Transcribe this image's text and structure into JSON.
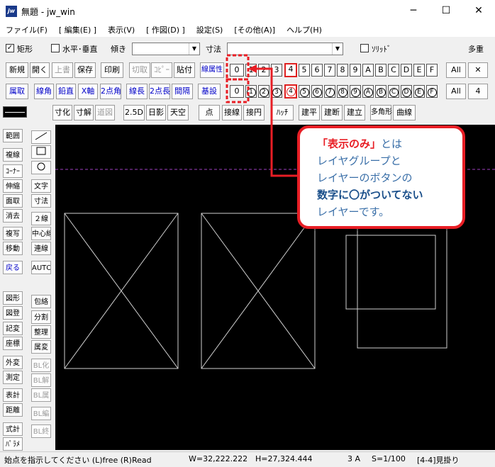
{
  "window": {
    "title": "無題 - jw_win",
    "logo": "jw",
    "minimize": "─",
    "maximize": "☐",
    "close": "✕"
  },
  "menu": [
    "ファイル(F)",
    "[ 編集(E) ]",
    "表示(V)",
    "[ 作図(D) ]",
    "設定(S)",
    "[その他(A)]",
    "ヘルプ(H)"
  ],
  "options": {
    "rect_label": "矩形",
    "rect_checked": "✓",
    "hv_label": "水平･垂直",
    "slope_label": "傾き",
    "dim_label": "寸法",
    "solid_label": "ｿﾘｯﾄﾞ",
    "multi_label": "多重"
  },
  "toolbar1": [
    "新規",
    "開く",
    "上書",
    "保存",
    "印刷",
    "切取",
    "ｺﾋﾟｰ",
    "貼付",
    "線属性"
  ],
  "toolbar2": [
    "属取",
    "線角",
    "鉛直",
    "X軸",
    "2点角",
    "線長",
    "2点長",
    "間隔",
    "基設"
  ],
  "toolbar3": [
    "寸化",
    "寸解",
    "道図",
    "2.5D",
    "日影",
    "天空",
    "点",
    "接線",
    "接円",
    "ﾊｯﾁ",
    "建平",
    "建断",
    "建立",
    "多角形",
    "曲線"
  ],
  "group_buttons": [
    "0",
    "1",
    "2",
    "3",
    "4",
    "5",
    "6",
    "7",
    "8",
    "9",
    "A",
    "B",
    "C",
    "D",
    "E",
    "F"
  ],
  "layer_buttons": [
    "0",
    "1",
    "2",
    "3",
    "4",
    "5",
    "6",
    "7",
    "8",
    "9",
    "A",
    "B",
    "C",
    "D",
    "E",
    "F"
  ],
  "all_label": "All",
  "all_label2": "All",
  "layer_count": "4",
  "left_tools": [
    "範囲",
    "複線",
    "ｺｰﾅｰ",
    "伸縮",
    "面取",
    "消去",
    "複写",
    "移動",
    "戻る"
  ],
  "left_tools2": [
    "文字",
    "寸法",
    "２線",
    "中心線",
    "連線",
    "AUTO"
  ],
  "left_tools3": [
    "図形",
    "図登",
    "記変",
    "座標",
    "外変",
    "測定",
    "表計",
    "距離",
    "式計",
    "ﾊﾟﾗﾒ"
  ],
  "left_tools4": [
    "包絡",
    "分割",
    "整理",
    "属変",
    "BL化",
    "BL解",
    "BL属",
    "BL編",
    "BL終"
  ],
  "callout": {
    "line1a": "「表示のみ」",
    "line1b": "とは",
    "line2": "レイヤグループと",
    "line3": "レイヤーのボタンの",
    "line4": "数字に〇がついてない",
    "line5": "レイヤーです。"
  },
  "status": {
    "message": "始点を指示してください (L)free (R)Read",
    "w": "W=32,222.222",
    "h": "H=27,324.444",
    "paper": "3 A",
    "scale": "S=1/100",
    "layer": "[4-4]見掛り"
  },
  "colors": {
    "accent": "#e81e25",
    "canvas": "#000000",
    "blue_text": "#0000c8"
  }
}
